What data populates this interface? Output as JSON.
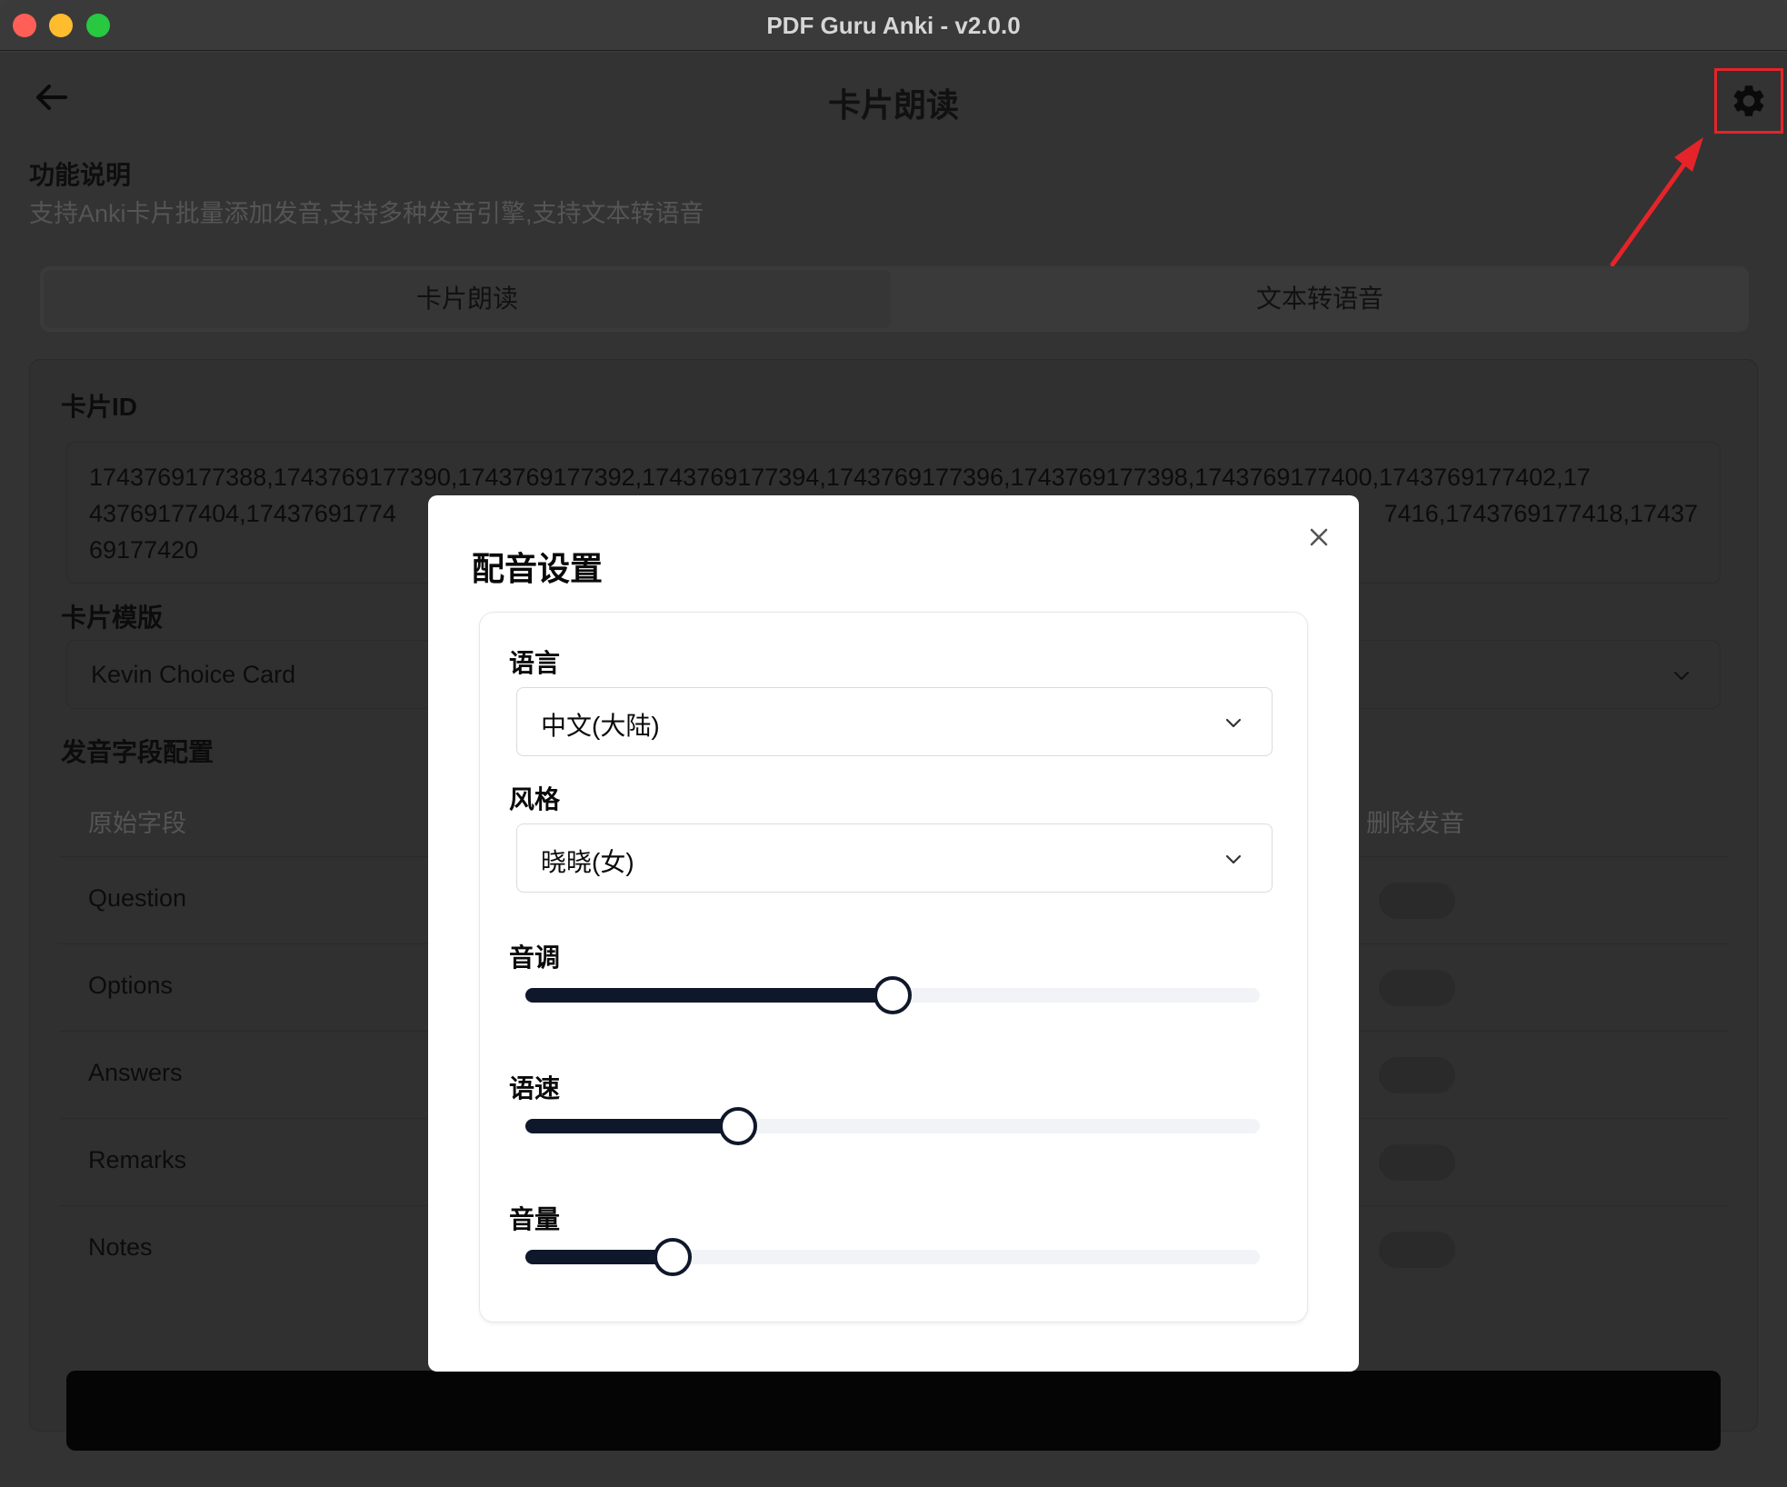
{
  "window": {
    "title": "PDF Guru Anki - v2.0.0"
  },
  "header": {
    "title": "卡片朗读",
    "back_icon": "arrow-left-icon",
    "settings_icon": "gear-icon"
  },
  "description": {
    "title": "功能说明",
    "text": "支持Anki卡片批量添加发音,支持多种发音引擎,支持文本转语音"
  },
  "tabs": [
    {
      "label": "卡片朗读"
    },
    {
      "label": "文本转语音"
    }
  ],
  "form": {
    "card_id_label": "卡片ID",
    "card_ids_visible_lines": [
      "1743769177388,1743769177390,1743769177392,1743769177394,1743769177396,1743769177398,1743769177400,1743769177402,17",
      "43769177404,17437691774",
      "7416,1743769177418,17437",
      "69177420"
    ],
    "template_label": "卡片模版",
    "template_value": "Kevin Choice Card",
    "field_config_label": "发音字段配置",
    "columns": {
      "source": "原始字段",
      "delete_partial": "删除发音"
    },
    "rows": [
      {
        "label": "Question"
      },
      {
        "label": "Options"
      },
      {
        "label": "Answers"
      },
      {
        "label": "Remarks"
      },
      {
        "label": "Notes"
      }
    ]
  },
  "modal": {
    "title": "配音设置",
    "close_icon": "close-icon",
    "language_label": "语言",
    "language_value": "中文(大陆)",
    "style_label": "风格",
    "style_value": "晓晓(女)",
    "pitch_label": "音调",
    "pitch_fraction": 0.5,
    "rate_label": "语速",
    "rate_fraction": 0.29,
    "volume_label": "音量",
    "volume_fraction": 0.2
  },
  "colors": {
    "annotation_red": "#e5242a",
    "slider_fill": "#0f172a"
  }
}
